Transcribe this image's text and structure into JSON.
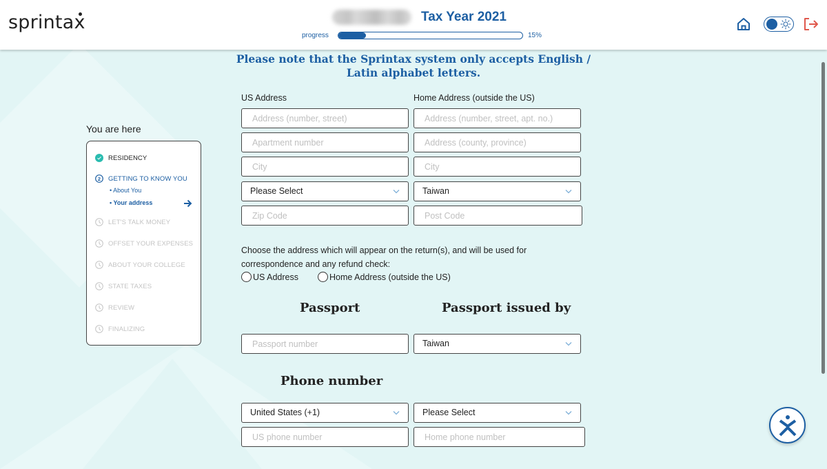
{
  "header": {
    "logo_text": "sprinta",
    "logo_last": "x",
    "tax_year": "Tax Year 2021",
    "progress_label": "progress",
    "progress_percent": 15,
    "progress_text": "15%",
    "icons": [
      "home-icon",
      "theme-toggle",
      "logout-icon"
    ]
  },
  "colors": {
    "brand_blue": "#1d5fa3",
    "completed_teal": "#2bbcb0",
    "logout_red": "#e0584c",
    "background": "#e2f5f5"
  },
  "sidebar": {
    "title": "You are here",
    "steps": [
      {
        "label": "RESIDENCY",
        "state": "done",
        "icon": "check-circle-icon"
      },
      {
        "label": "GETTING TO KNOW YOU",
        "state": "current",
        "icon": "step-2-icon",
        "substeps": [
          {
            "label": "• About You",
            "active": false
          },
          {
            "label": "• Your address",
            "active": true
          }
        ]
      },
      {
        "label": "LET'S TALK MONEY",
        "state": "pending",
        "icon": "clock-icon"
      },
      {
        "label": "OFFSET YOUR EXPENSES",
        "state": "pending",
        "icon": "clock-icon"
      },
      {
        "label": "ABOUT YOUR COLLEGE",
        "state": "pending",
        "icon": "clock-icon"
      },
      {
        "label": "STATE TAXES",
        "state": "pending",
        "icon": "clock-icon"
      },
      {
        "label": "REVIEW",
        "state": "pending",
        "icon": "clock-icon"
      },
      {
        "label": "FINALIZING",
        "state": "pending",
        "icon": "clock-icon"
      }
    ]
  },
  "main": {
    "notice": "Please note that the Sprintax system only accepts English / Latin alphabet letters.",
    "us_address": {
      "label": "US Address",
      "street_placeholder": "Address (number, street)",
      "apartment_placeholder": "Apartment number",
      "city_placeholder": "City",
      "state_select": "Please Select",
      "zip_placeholder": "Zip Code"
    },
    "home_address": {
      "label": "Home Address (outside the US)",
      "street_placeholder": "Address (number, street, apt. no.)",
      "county_placeholder": "Address (county, province)",
      "city_placeholder": "City",
      "country_select": "Taiwan",
      "post_placeholder": "Post Code"
    },
    "address_choice": {
      "prompt": "Choose the address which will appear on the return(s), and will be used for correspondence and any refund check:",
      "options": [
        "US Address",
        "Home Address (outside the US)"
      ],
      "selected": null
    },
    "passport": {
      "heading": "Passport",
      "issued_heading": "Passport issued by",
      "number_placeholder": "Passport number",
      "issued_by_select": "Taiwan"
    },
    "phone": {
      "heading": "Phone number",
      "us_code_select": "United States (+1)",
      "home_code_select": "Please Select",
      "us_placeholder": "US phone number",
      "home_placeholder": "Home phone number"
    }
  },
  "help_widget": {
    "icon": "sprintax-help-icon"
  }
}
